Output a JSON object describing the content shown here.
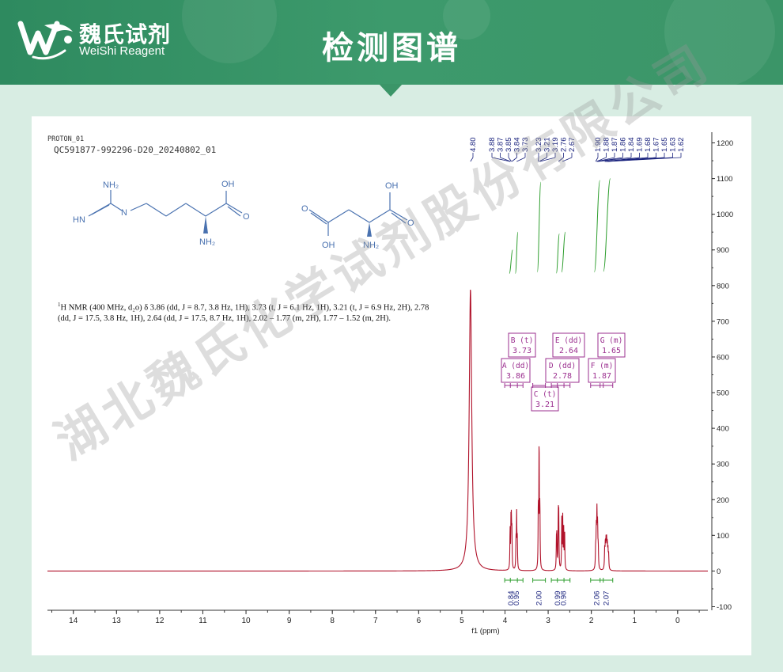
{
  "header": {
    "brand_cn": "魏氏试剂",
    "brand_en": "WeiShi Reagent",
    "title": "检测图谱",
    "colors": {
      "header": "#3b9568",
      "background": "#d8ede3"
    }
  },
  "spectrum_header": {
    "line1": "PROTON_01",
    "line2": "QC591877-992296-D20_20240802_01"
  },
  "nmr_description": {
    "sup": "1",
    "text": "H NMR (400 MHz, d₂o) δ 3.86 (dd, J = 8.7, 3.8 Hz, 1H), 3.73 (t, J = 6.1 Hz, 1H), 3.21 (t, J = 6.9 Hz, 2H), 2.78 (dd, J = 17.5, 3.8 Hz, 1H), 2.64 (dd, J = 17.5, 8.7 Hz, 1H), 2.02 – 1.77 (m, 2H), 1.77 – 1.52 (m, 2H)."
  },
  "structures": {
    "arginine": {
      "labels": [
        "NH₂",
        "HN",
        "N",
        "OH",
        "O",
        "NH₂",
        "H"
      ]
    },
    "aspartic_acid": {
      "labels": [
        "O",
        "OH",
        "OH",
        "O",
        "NH₂"
      ]
    }
  },
  "watermark": "湖北魏氏化学试剂股份有限公司",
  "chart_data": {
    "type": "line",
    "xlabel": "f1 (ppm)",
    "xlim": [
      14.6,
      -0.7
    ],
    "ylim": [
      -110,
      1230
    ],
    "x_ticks": [
      "14",
      "13",
      "12",
      "11",
      "10",
      "9",
      "8",
      "7",
      "6",
      "5",
      "4",
      "3",
      "2",
      "1",
      "0"
    ],
    "y_ticks": [
      "-100",
      "0",
      "100",
      "200",
      "300",
      "400",
      "500",
      "600",
      "700",
      "800",
      "900",
      "1000",
      "1100",
      "1200"
    ],
    "peak_labels": [
      "4.80",
      "3.88",
      "3.87",
      "3.85",
      "3.84",
      "3.73",
      "3.23",
      "3.21",
      "3.19",
      "2.76",
      "2.67",
      "1.90",
      "1.88",
      "1.87",
      "1.86",
      "1.84",
      "1.69",
      "1.68",
      "1.67",
      "1.65",
      "1.63",
      "1.62"
    ],
    "series": [
      {
        "peaks": [
          {
            "ppm": 4.8,
            "height": 790,
            "width": 0.035
          },
          {
            "ppm": 3.882,
            "height": 110,
            "width": 0.006
          },
          {
            "ppm": 3.862,
            "height": 120,
            "width": 0.006
          },
          {
            "ppm": 3.852,
            "height": 115,
            "width": 0.006
          },
          {
            "ppm": 3.84,
            "height": 100,
            "width": 0.006
          },
          {
            "ppm": 3.745,
            "height": 80,
            "width": 0.006
          },
          {
            "ppm": 3.73,
            "height": 150,
            "width": 0.006
          },
          {
            "ppm": 3.715,
            "height": 80,
            "width": 0.006
          },
          {
            "ppm": 3.228,
            "height": 170,
            "width": 0.006
          },
          {
            "ppm": 3.21,
            "height": 350,
            "width": 0.006
          },
          {
            "ppm": 3.192,
            "height": 170,
            "width": 0.006
          },
          {
            "ppm": 2.808,
            "height": 80,
            "width": 0.006
          },
          {
            "ppm": 2.798,
            "height": 85,
            "width": 0.006
          },
          {
            "ppm": 2.765,
            "height": 140,
            "width": 0.006
          },
          {
            "ppm": 2.755,
            "height": 145,
            "width": 0.006
          },
          {
            "ppm": 2.685,
            "height": 140,
            "width": 0.006
          },
          {
            "ppm": 2.663,
            "height": 145,
            "width": 0.006
          },
          {
            "ppm": 2.64,
            "height": 110,
            "width": 0.006
          },
          {
            "ppm": 2.618,
            "height": 105,
            "width": 0.006
          },
          {
            "ppm": 1.9,
            "height": 55,
            "width": 0.007
          },
          {
            "ppm": 1.885,
            "height": 100,
            "width": 0.007
          },
          {
            "ppm": 1.87,
            "height": 145,
            "width": 0.007
          },
          {
            "ppm": 1.855,
            "height": 110,
            "width": 0.007
          },
          {
            "ppm": 1.84,
            "height": 55,
            "width": 0.007
          },
          {
            "ppm": 1.69,
            "height": 55,
            "width": 0.007
          },
          {
            "ppm": 1.675,
            "height": 65,
            "width": 0.007
          },
          {
            "ppm": 1.66,
            "height": 70,
            "width": 0.007
          },
          {
            "ppm": 1.645,
            "height": 70,
            "width": 0.007
          },
          {
            "ppm": 1.63,
            "height": 62,
            "width": 0.007
          },
          {
            "ppm": 1.615,
            "height": 50,
            "width": 0.007
          },
          {
            "ppm": 1.6,
            "height": 40,
            "width": 0.007
          }
        ],
        "color": "#b0122a"
      }
    ],
    "integration_labels": [
      "0.84",
      "0.95",
      "2.00",
      "0.99",
      "0.98",
      "2.06",
      "2.07"
    ],
    "multiplets": [
      {
        "letter": "A",
        "type": "dd",
        "ppm": "3.86"
      },
      {
        "letter": "B",
        "type": "t",
        "ppm": "3.73"
      },
      {
        "letter": "C",
        "type": "t",
        "ppm": "3.21"
      },
      {
        "letter": "D",
        "type": "dd",
        "ppm": "2.78"
      },
      {
        "letter": "E",
        "type": "dd",
        "ppm": "2.64"
      },
      {
        "letter": "F",
        "type": "m",
        "ppm": "1.87"
      },
      {
        "letter": "G",
        "type": "m",
        "ppm": "1.65"
      }
    ],
    "colors": {
      "spectrum": "#b0122a",
      "integral": "#2e9e2e",
      "peak_label": "#1a237e",
      "multiplet_box": "#9b2f8f"
    }
  }
}
